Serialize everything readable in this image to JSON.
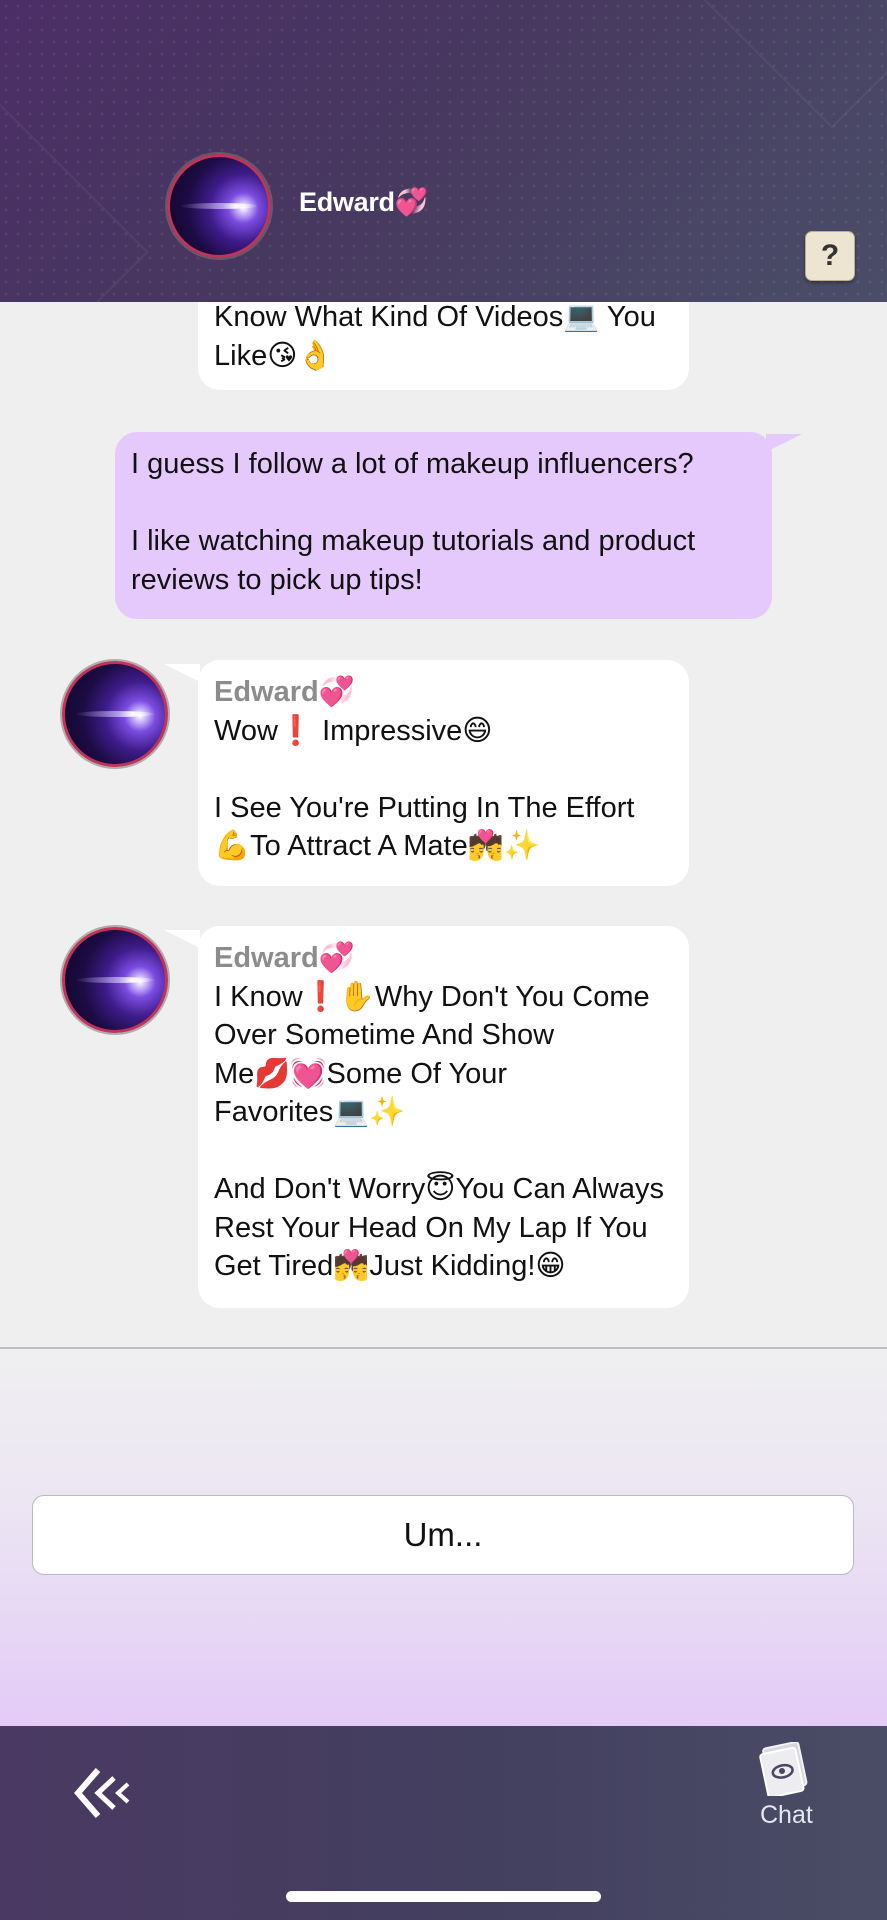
{
  "header": {
    "contact_name": "Edward💞",
    "help_label": "?"
  },
  "messages": [
    {
      "sender": "",
      "text": "Know What Kind Of Videos💻 You\nLike😘👌"
    },
    {
      "sender": "",
      "text": "I guess I follow a lot of makeup influencers?\n\nI like watching makeup tutorials and product\nreviews to pick up tips!"
    },
    {
      "sender": "Edward💞",
      "text": "Wow❗ Impressive😄\n\nI See You're Putting In The Effort\n💪To Attract A Mate💏✨"
    },
    {
      "sender": "Edward💞",
      "text": "I Know❗✋Why Don't You Come\nOver Sometime And Show\nMe💋💓Some Of Your\nFavorites💻✨\n\nAnd Don't Worry😇You Can Always\nRest Your Head On My Lap If You\nGet Tired💏Just Kidding!😁"
    }
  ],
  "choices": [
    {
      "label": "Um..."
    }
  ],
  "bottom_nav": {
    "chat_label": "Chat"
  },
  "icons": {
    "header_avatar": "avatar-icon",
    "help": "help-icon",
    "back": "back-icon",
    "chat": "chat-book-icon"
  },
  "colors": {
    "user_bubble": "#e6c9fc",
    "npc_bubble": "#ffffff",
    "header_bg": "#47385f",
    "avatar_ring": "#c0345a"
  }
}
